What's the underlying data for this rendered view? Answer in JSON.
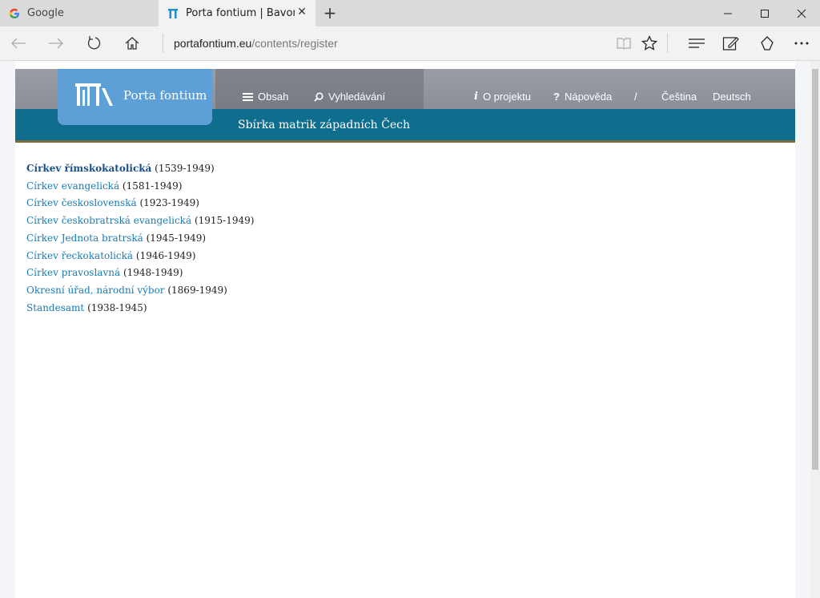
{
  "browser": {
    "tabs": [
      {
        "title": "Google",
        "active": false,
        "favicon": "google-g-icon"
      },
      {
        "title": "Porta fontium | Bavorsk",
        "active": true,
        "favicon": "porta-fontium-favicon"
      }
    ],
    "url": {
      "host": "portafontium.eu",
      "path": "/contents/register"
    }
  },
  "header": {
    "logo_text": "Porta fontium",
    "nav_left": [
      {
        "label": "Obsah",
        "icon": "hamburger-icon"
      },
      {
        "label": "Vyhledávání",
        "icon": "search-icon"
      }
    ],
    "nav_right": [
      {
        "label": "O projektu",
        "icon": "info-icon"
      },
      {
        "label": "Nápověda",
        "icon": "help-icon"
      }
    ],
    "lang_separator": "/",
    "languages": [
      "Čeština",
      "Deutsch"
    ],
    "collection_title": "Sbírka matrik západních Čech"
  },
  "registers": [
    {
      "name": "Církev římskokatolická",
      "years": "(1539-1949)"
    },
    {
      "name": "Církev evangelická",
      "years": "(1581-1949)"
    },
    {
      "name": "Církev československá",
      "years": "(1923-1949)"
    },
    {
      "name": "Církev českobratrská evangelická",
      "years": "(1915-1949)"
    },
    {
      "name": "Církev Jednota bratrská",
      "years": "(1945-1949)"
    },
    {
      "name": "Církev řeckokatolická",
      "years": "(1946-1949)"
    },
    {
      "name": "Církev pravoslavná",
      "years": "(1948-1949)"
    },
    {
      "name": "Okresní úřad, národní výbor",
      "years": "(1869-1949)"
    },
    {
      "name": "Standesamt",
      "years": "(1938-1945)"
    }
  ],
  "colors": {
    "header_gray": "#8f949d",
    "header_blue": "#0f6e8e",
    "logo_blue": "#5d9fd6",
    "link": "#1b7bb3"
  }
}
